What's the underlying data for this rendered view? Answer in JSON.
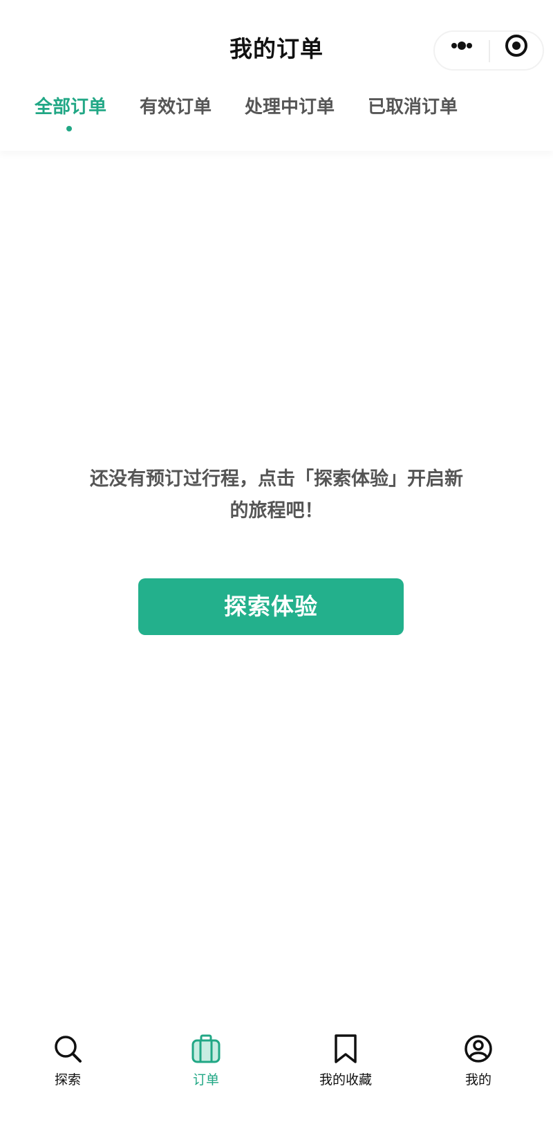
{
  "header": {
    "title": "我的订单",
    "more_icon": "more-dots-icon",
    "close_icon": "target-close-icon"
  },
  "tabs": [
    {
      "label": "全部订单",
      "active": true
    },
    {
      "label": "有效订单",
      "active": false
    },
    {
      "label": "处理中订单",
      "active": false
    },
    {
      "label": "已取消订单",
      "active": false
    }
  ],
  "empty_state": {
    "line1": "还没有预订过行程，点击「探索体验」开启新",
    "line2": "的旅程吧！",
    "button_label": "探索体验"
  },
  "tabbar": [
    {
      "label": "探索",
      "icon": "search-icon",
      "active": false
    },
    {
      "label": "订单",
      "icon": "luggage-icon",
      "active": true
    },
    {
      "label": "我的收藏",
      "icon": "bookmark-icon",
      "active": false
    },
    {
      "label": "我的",
      "icon": "user-circle-icon",
      "active": false
    }
  ],
  "colors": {
    "accent": "#21a785",
    "button": "#23b08c",
    "text_primary": "#111111",
    "text_secondary": "#555555"
  }
}
